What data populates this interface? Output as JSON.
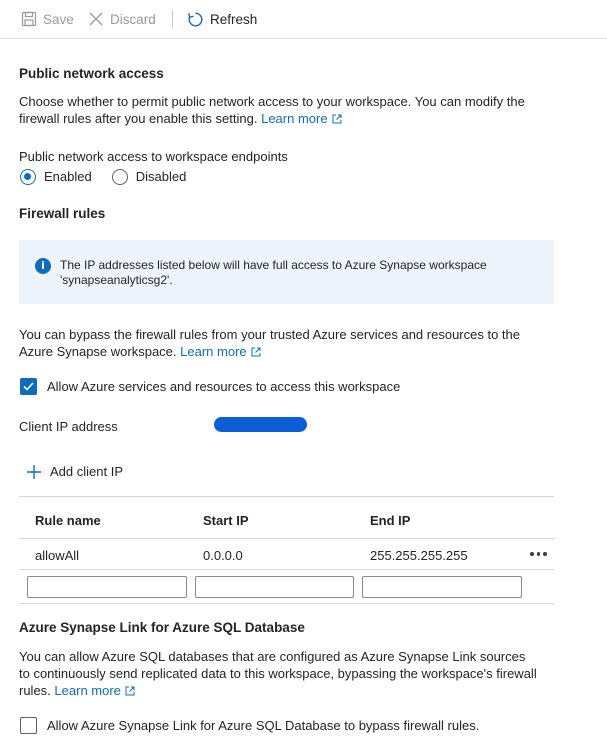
{
  "toolbar": {
    "save_label": "Save",
    "discard_label": "Discard",
    "refresh_label": "Refresh"
  },
  "public_access": {
    "title": "Public network access",
    "description": "Choose whether to permit public network access to your workspace. You can modify the firewall rules after you enable this setting.",
    "learn_more": "Learn more",
    "endpoints_label": "Public network access to workspace endpoints",
    "options": [
      "Enabled",
      "Disabled"
    ],
    "selected": "Enabled"
  },
  "firewall": {
    "title": "Firewall rules",
    "info_text": "The IP addresses listed below will have full access to Azure Synapse workspace 'synapseanalyticsg2'.",
    "bypass_text": "You can bypass the firewall rules from your trusted Azure services and resources to the Azure Synapse workspace.",
    "learn_more": "Learn more",
    "allow_azure_label": "Allow Azure services and resources to access this workspace",
    "allow_azure_checked": true,
    "client_ip_label": "Client IP address",
    "add_client_ip_label": "Add client IP",
    "table": {
      "headers": [
        "Rule name",
        "Start IP",
        "End IP"
      ],
      "rows": [
        {
          "rule_name": "allowAll",
          "start_ip": "0.0.0.0",
          "end_ip": "255.255.255.255"
        }
      ]
    }
  },
  "synapse_link": {
    "title": "Azure Synapse Link for Azure SQL Database",
    "description": "You can allow Azure SQL databases that are configured as Azure Synapse Link sources to continuously send replicated data to this workspace, bypassing the workspace's firewall rules.",
    "learn_more": "Learn more",
    "checkbox_label": "Allow Azure Synapse Link for Azure SQL Database to bypass firewall rules.",
    "checked": false
  },
  "colors": {
    "accent": "#0f6cbd",
    "info_bg": "#eef4fb",
    "ip_mask": "#0b5ed7"
  }
}
